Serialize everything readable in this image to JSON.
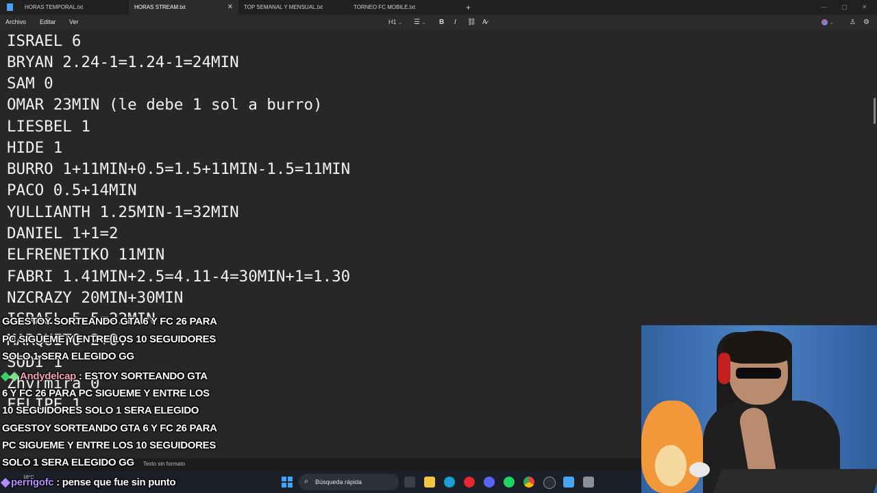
{
  "tabs": [
    {
      "label": "HORAS TEMPORAL.txt",
      "active": false
    },
    {
      "label": "HORAS STREAM.txt",
      "active": true
    },
    {
      "label": "TOP SEMANAL Y MENSUAL.txt",
      "active": false
    },
    {
      "label": "TORNEO FC MOBILE.txt",
      "active": false
    }
  ],
  "tab_close_glyph": "✕",
  "new_tab_glyph": "+",
  "menu": {
    "file": "Archivo",
    "edit": "Editar",
    "view": "Ver"
  },
  "toolbar": {
    "heading": "H1",
    "bold": "B",
    "italic": "I"
  },
  "editor_lines": [
    "ISRAEL 6",
    "BRYAN 2.24-1=1.24-1=24MIN",
    "SAM 0",
    "OMAR 23MIN (le debe 1 sol a burro)",
    "LIESBEL 1",
    "HIDE 1",
    "BURRO 1+11MIN+0.5=1.5+11MIN-1.5=11MIN",
    "PACO 0.5+14MIN",
    "YULLIANTH 1.25MIN-1=32MIN",
    "DANIEL 1+1=2",
    "ELFRENETIKO 11MIN",
    "FABRI 1.41MIN+2.5=4.11-4=30MIN+1=1.30",
    "NZCRAZY 20MIN+30MIN",
    "ISRAEL 5.5=22MIN",
    "MARQUITO 2+0.",
    "SODI 1",
    "Zhvrmira 0",
    "FELIPE 1"
  ],
  "status": {
    "format": "Texto sin formato"
  },
  "taskbar": {
    "search_label": "Búsqueda rápida",
    "weather": "16°C"
  },
  "chat_overlay": [
    {
      "user": "",
      "text": "GGESTOY SORTEANDO GTA 6 Y FC 26 PARA"
    },
    {
      "user": "",
      "text": "PC SIGUEME Y ENTRE LOS 10 SEGUIDORES"
    },
    {
      "user": "",
      "text": "SOLO 1 SERA ELEGIDO GG"
    },
    {
      "user": "Andydelcap",
      "text": ": ESTOY SORTEANDO GTA"
    },
    {
      "user": "",
      "text": "6 Y FC 26 PARA PC SIGUEME Y ENTRE LOS"
    },
    {
      "user": "",
      "text": "10 SEGUIDORES SOLO 1 SERA ELEGIDO"
    },
    {
      "user": "",
      "text": "GGESTOY SORTEANDO GTA 6 Y FC 26 PARA"
    },
    {
      "user": "",
      "text": "PC SIGUEME Y ENTRE LOS 10 SEGUIDORES"
    },
    {
      "user": "",
      "text": "SOLO 1 SERA ELEGIDO GG"
    },
    {
      "user": "perrigofc",
      "text": ": pense que fue sin punto"
    }
  ],
  "colors": {
    "editor_bg": "#272727",
    "chat_user_pink": "#f4a2b8",
    "chat_user_purple": "#b58bff",
    "accent_blue": "#3ea6ff"
  }
}
